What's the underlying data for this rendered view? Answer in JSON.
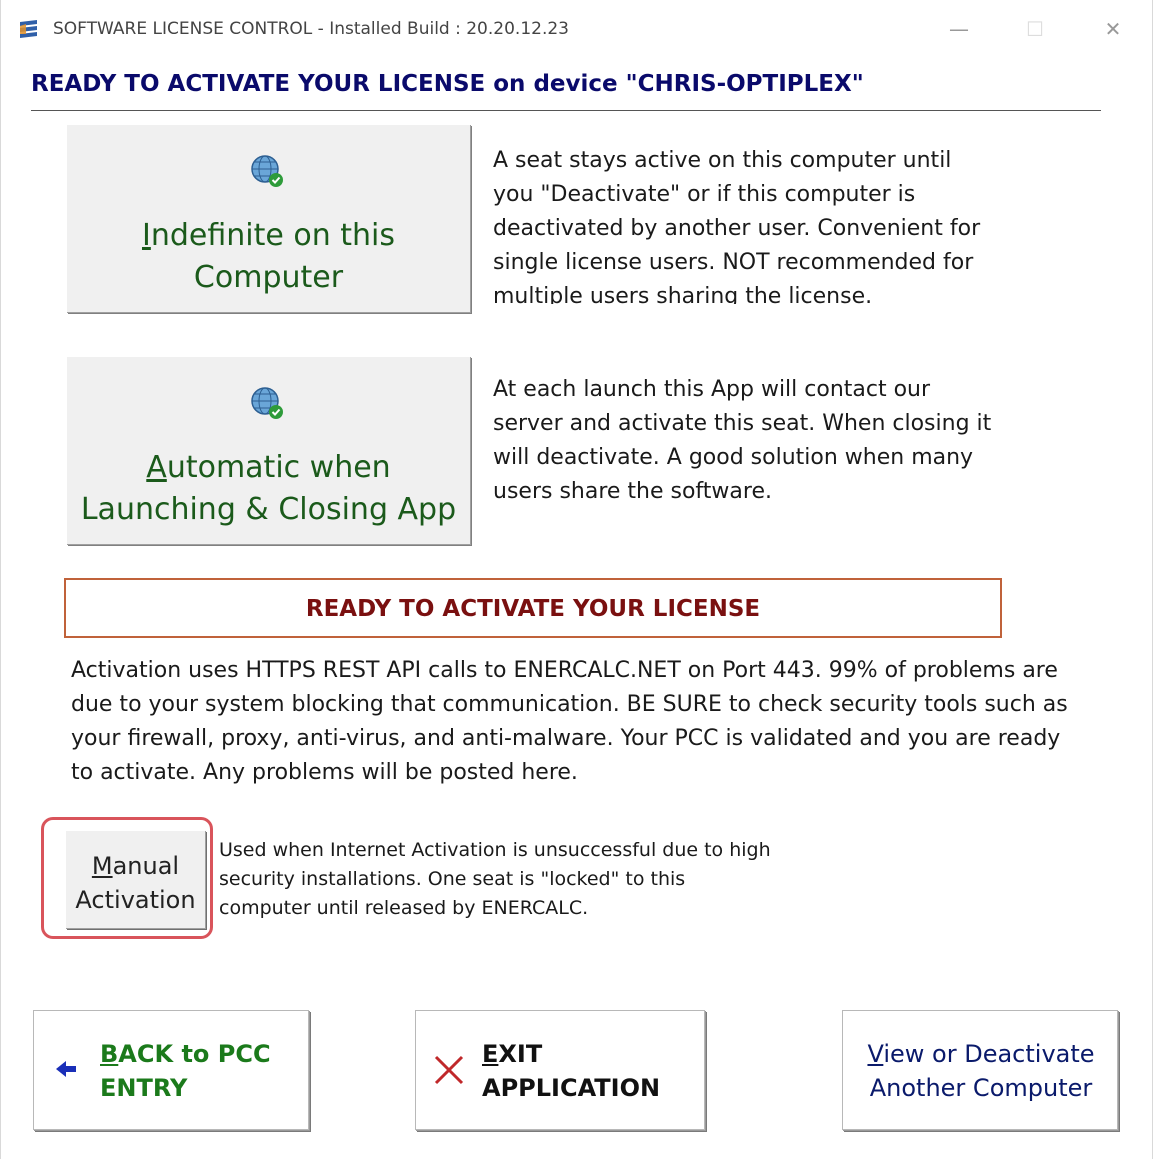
{
  "window": {
    "title": "SOFTWARE LICENSE CONTROL  -  Installed Build : 20.20.12.23",
    "minimize": "—",
    "maximize": "☐",
    "close": "✕"
  },
  "heading": "READY TO ACTIVATE YOUR LICENSE on device  \"CHRIS-OPTIPLEX\"",
  "options": [
    {
      "label_first": "I",
      "label_rest": "ndefinite on this",
      "label_line2": "Computer",
      "icon": "globe-check-icon",
      "description": "A seat stays active on this computer until you \"Deactivate\" or if this computer is deactivated by another user. Convenient for single license users. NOT recommended for multiple users sharing the license."
    },
    {
      "label_first": "A",
      "label_rest": "utomatic when",
      "label_line2": "Launching & Closing App",
      "icon": "globe-check-icon",
      "description": "At each launch this App will contact our server and activate this seat. When closing it will deactivate. A good solution when many users share the software."
    }
  ],
  "status_box": "READY TO ACTIVATE YOUR LICENSE",
  "status_message": "Activation uses HTTPS REST API calls to ENERCALC.NET on Port 443. 99% of problems are due to your system blocking that communication. BE SURE to check security tools such as your firewall, proxy, anti-virus, and anti-malware. Your PCC is validated and you are ready to activate. Any problems will be posted here.",
  "manual": {
    "label_first": "M",
    "label_rest": "anual",
    "label_line2": "Activation",
    "note": "Used when Internet Activation is unsuccessful due to high security installations. One seat is \"locked\" to this computer until released by ENERCALC."
  },
  "footer": {
    "back": {
      "first": "B",
      "rest": "ACK to PCC",
      "line2": "ENTRY",
      "color": "#1b7a1b"
    },
    "exit": {
      "first": "E",
      "rest": "XIT",
      "line2": "APPLICATION",
      "color": "#111111"
    },
    "view": {
      "first": "V",
      "rest": "iew or Deactivate",
      "line2": "Another Computer",
      "color": "#0a1a6b"
    }
  }
}
